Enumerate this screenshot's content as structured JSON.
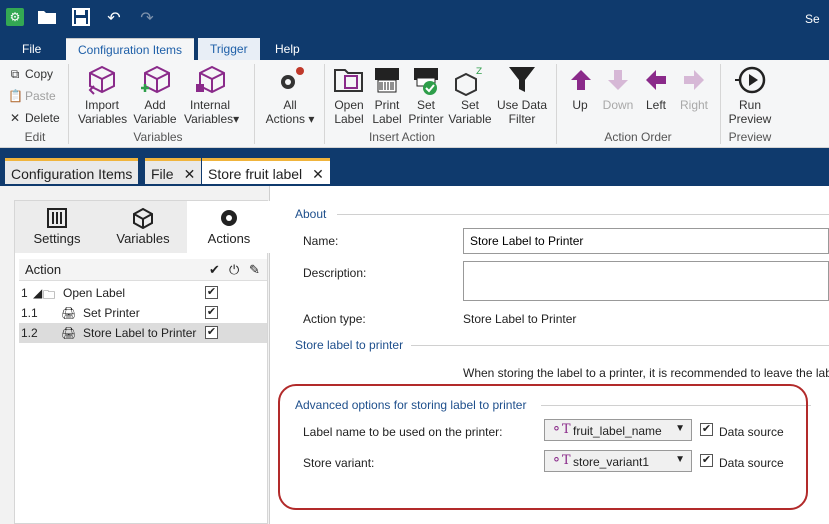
{
  "window": {
    "title_fragment": "Se"
  },
  "titlebar_icons": [
    "app-icon",
    "folder-icon",
    "save-icon",
    "undo-icon",
    "redo-icon"
  ],
  "menu_tabs": {
    "file": "File",
    "config": "Configuration Items",
    "trigger": "Trigger",
    "help": "Help"
  },
  "ribbon": {
    "edit": {
      "copy": "Copy",
      "paste": "Paste",
      "delete": "Delete",
      "label": "Edit"
    },
    "variables": {
      "import": [
        "Import",
        "Variables"
      ],
      "add": [
        "Add",
        "Variable"
      ],
      "internal": [
        "Internal",
        "Variables"
      ],
      "label": "Variables"
    },
    "all_actions": [
      "All",
      "Actions"
    ],
    "insert": {
      "open": [
        "Open",
        "Label"
      ],
      "print": [
        "Print",
        "Label"
      ],
      "setprinter": [
        "Set",
        "Printer"
      ],
      "setvar": [
        "Set",
        "Variable"
      ],
      "datafilter": [
        "Use Data",
        "Filter"
      ],
      "label": "Insert Action"
    },
    "order": {
      "up": "Up",
      "down": "Down",
      "left": "Left",
      "right": "Right",
      "label": "Action Order"
    },
    "preview": {
      "run": [
        "Run",
        "Preview"
      ],
      "label": "Preview"
    }
  },
  "doc_tabs": {
    "config": "Configuration Items",
    "file": "File",
    "store": "Store fruit label"
  },
  "left_tabs": {
    "settings": "Settings",
    "variables": "Variables",
    "actions": "Actions"
  },
  "grid": {
    "action_header": "Action",
    "rows": [
      {
        "num": "1",
        "label": "Open Label"
      },
      {
        "num": "1.1",
        "label": "Set Printer"
      },
      {
        "num": "1.2",
        "label": "Store Label to Printer"
      }
    ]
  },
  "about": {
    "section": "About",
    "name_label": "Name:",
    "name_value": "Store Label to Printer",
    "desc_label": "Description:",
    "type_label": "Action type:",
    "type_value": "Store Label to Printer"
  },
  "store": {
    "section": "Store label to printer",
    "note": "When storing the label to a printer, it is recommended to leave the lab"
  },
  "advanced": {
    "section": "Advanced options for storing label to printer",
    "label_name_label": "Label name to be used on the printer:",
    "label_name_value": "fruit_label_name",
    "variant_label": "Store variant:",
    "variant_value": "store_variant1",
    "datasource": "Data source"
  }
}
